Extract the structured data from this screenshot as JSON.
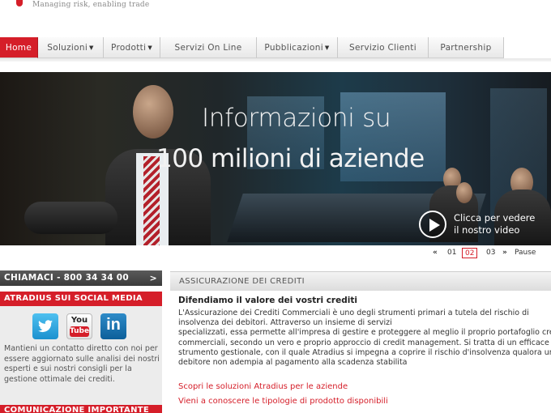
{
  "header": {
    "tagline": "Managing risk, enabling trade"
  },
  "nav": {
    "items": [
      {
        "label": "Home",
        "active": true,
        "dropdown": false
      },
      {
        "label": "Soluzioni",
        "active": false,
        "dropdown": true
      },
      {
        "label": "Prodotti",
        "active": false,
        "dropdown": true
      },
      {
        "label": "Servizi On Line",
        "active": false,
        "dropdown": false
      },
      {
        "label": "Pubblicazioni",
        "active": false,
        "dropdown": true
      },
      {
        "label": "Servizio Clienti",
        "active": false,
        "dropdown": false
      },
      {
        "label": "Partnership",
        "active": false,
        "dropdown": false
      }
    ],
    "caret": "▼"
  },
  "hero": {
    "line1": "Informazioni su",
    "line2": "100 milioni di aziende",
    "video_caption_1": "Clicca per vedere",
    "video_caption_2": "il nostro video"
  },
  "slider": {
    "prev": "«",
    "pages": [
      "01",
      "02",
      "03"
    ],
    "current": "02",
    "next": "»",
    "pause": "Pause"
  },
  "sidebar": {
    "call_label": "CHIAMACI - 800 34 34 00",
    "call_arrow": ">",
    "social_title": "ATRADIUS SUI SOCIAL MEDIA",
    "social_icons": [
      "twitter-icon",
      "youtube-icon",
      "linkedin-icon"
    ],
    "youtube_you": "You",
    "youtube_tube": "Tube",
    "linkedin_text": "in",
    "social_text": "Mantieni un contatto diretto con noi per essere aggiornato sulle analisi dei nostri esperti e sui nostri consigli per la gestione ottimale dei crediti.",
    "notice_title": "COMUNICAZIONE IMPORTANTE"
  },
  "main": {
    "section_title": "ASSICURAZIONE DEI CREDITI",
    "heading": "Difendiamo il valore dei vostri crediti",
    "body_lines": [
      "L'Assicurazione dei Crediti Commerciali è uno degli strumenti primari a  tutela del rischio di",
      "insolvenza dei debitori. Attraverso un insieme di servizi",
      "specializzati, essa permette all'impresa di gestire e proteggere al meglio il proprio portafoglio crediti",
      "commerciali, secondo un vero e proprio approccio di credit management. Si tratta di un efficace",
      "strumento gestionale, con il  quale Atradius si impegna a coprire il rischio d'insolvenza qualora un",
      "debitore non adempia al pagamento alla scadenza stabilita"
    ],
    "link1": "Scopri le soluzioni Atradius per le aziende",
    "link2": "Vieni a conoscere le tipologie di prodotto disponibili"
  },
  "colors": {
    "brand_red": "#d51e29",
    "nav_bg": "#eeeeee",
    "sidebar_dark": "#4a4a4a"
  }
}
